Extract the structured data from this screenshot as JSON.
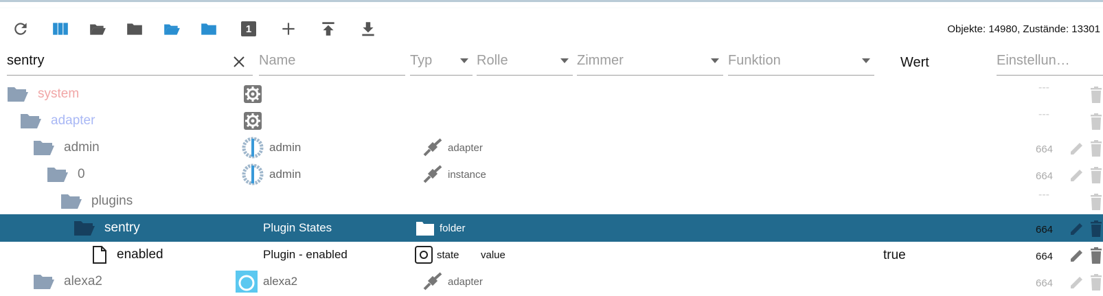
{
  "toolbar": {
    "buttons": [
      "refresh-icon",
      "columns-icon",
      "folder-open-icon",
      "folder-closed-icon",
      "folder-open-blue-icon",
      "folder-closed-blue-icon",
      "one-icon",
      "add-icon",
      "upload-icon",
      "download-icon"
    ],
    "one_label": "1",
    "counts": "Objekte: 14980, Zustände: 13301"
  },
  "filters": {
    "id_value": "sentry",
    "name_placeholder": "Name",
    "typ_placeholder": "Typ",
    "rolle_placeholder": "Rolle",
    "zimmer_placeholder": "Zimmer",
    "funktion_placeholder": "Funktion",
    "wert_header": "Wert",
    "einstellungen_placeholder": "Einstellun…"
  },
  "colors": {
    "selected_row": "#226a8e",
    "folder_gray": "#8da0b6",
    "folder_blue": "#3a9ad9",
    "system_text": "#f1a6a6",
    "adapter_text": "#a9b8f5"
  },
  "rows": [
    {
      "name": "system",
      "icon": "gear-icon",
      "col2": "",
      "role_icon": "",
      "role": "",
      "func": "",
      "wert": "",
      "num": "---",
      "actions": "trash"
    },
    {
      "name": "adapter",
      "icon": "gear-icon",
      "col2": "",
      "role_icon": "",
      "role": "",
      "func": "",
      "wert": "",
      "num": "---",
      "actions": "trash"
    },
    {
      "name": "admin",
      "icon": "admin-logo-icon",
      "col2": "admin",
      "role_icon": "adapter-plug-icon",
      "role": "adapter",
      "func": "",
      "wert": "",
      "num": "664",
      "actions": "pencil-trash"
    },
    {
      "name": "0",
      "icon": "admin-logo-icon",
      "col2": "admin",
      "role_icon": "adapter-plug-icon",
      "role": "instance",
      "func": "",
      "wert": "",
      "num": "664",
      "actions": "pencil-trash"
    },
    {
      "name": "plugins",
      "icon": "",
      "col2": "",
      "role_icon": "",
      "role": "",
      "func": "",
      "wert": "",
      "num": "---",
      "actions": "trash"
    },
    {
      "name": "sentry",
      "icon": "",
      "col2": "Plugin States",
      "role_icon": "folder-white-icon",
      "role": "folder",
      "func": "",
      "wert": "",
      "num": "664",
      "actions": "pencil-trash"
    },
    {
      "name": "enabled",
      "icon": "",
      "col2": "Plugin - enabled",
      "role_icon": "state-icon",
      "role": "state",
      "func": "value",
      "wert": "true",
      "num": "664",
      "actions": "pencil-trash"
    },
    {
      "name": "alexa2",
      "icon": "alexa-logo-icon",
      "col2": "alexa2",
      "role_icon": "adapter-plug-icon",
      "role": "adapter",
      "func": "",
      "wert": "",
      "num": "664",
      "actions": "pencil-trash"
    }
  ]
}
